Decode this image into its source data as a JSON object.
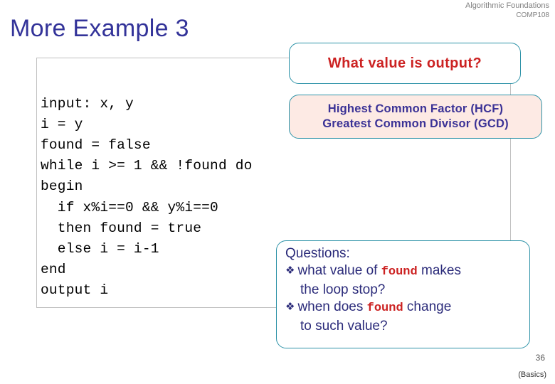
{
  "header": {
    "course_name": "Algorithmic Foundations",
    "course_code": "COMP108"
  },
  "title": "More Example 3",
  "code": {
    "listing": "input: x, y\ni = y\nfound = false\nwhile i >= 1 && !found do\nbegin\n  if x%i==0 && y%i==0\n  then found = true\n  else i = i-1\nend\noutput i"
  },
  "callouts": {
    "output_question": {
      "text": "What value is output?",
      "color": "#cc2222",
      "border_color": "#2e93a8"
    },
    "hcf": {
      "line1": "Highest Common Factor (HCF)",
      "line2": "Greatest Common Divisor (GCD)",
      "color": "#3b3296",
      "background": "#fdeae4",
      "border_color": "#2e93a8"
    },
    "questions": {
      "heading": "Questions:",
      "bullet_glyph": "❖",
      "items": [
        {
          "prefix": "what value of ",
          "code": "found",
          "suffix": " makes",
          "continuation": "the loop stop?"
        },
        {
          "prefix": "when does ",
          "code": "found",
          "suffix": " change",
          "continuation": "to such value?"
        }
      ],
      "color": "#2b2b7a",
      "code_color": "#cc2222",
      "border_color": "#2e93a8"
    }
  },
  "footer": {
    "page_number": "36",
    "note": "(Basics)"
  }
}
